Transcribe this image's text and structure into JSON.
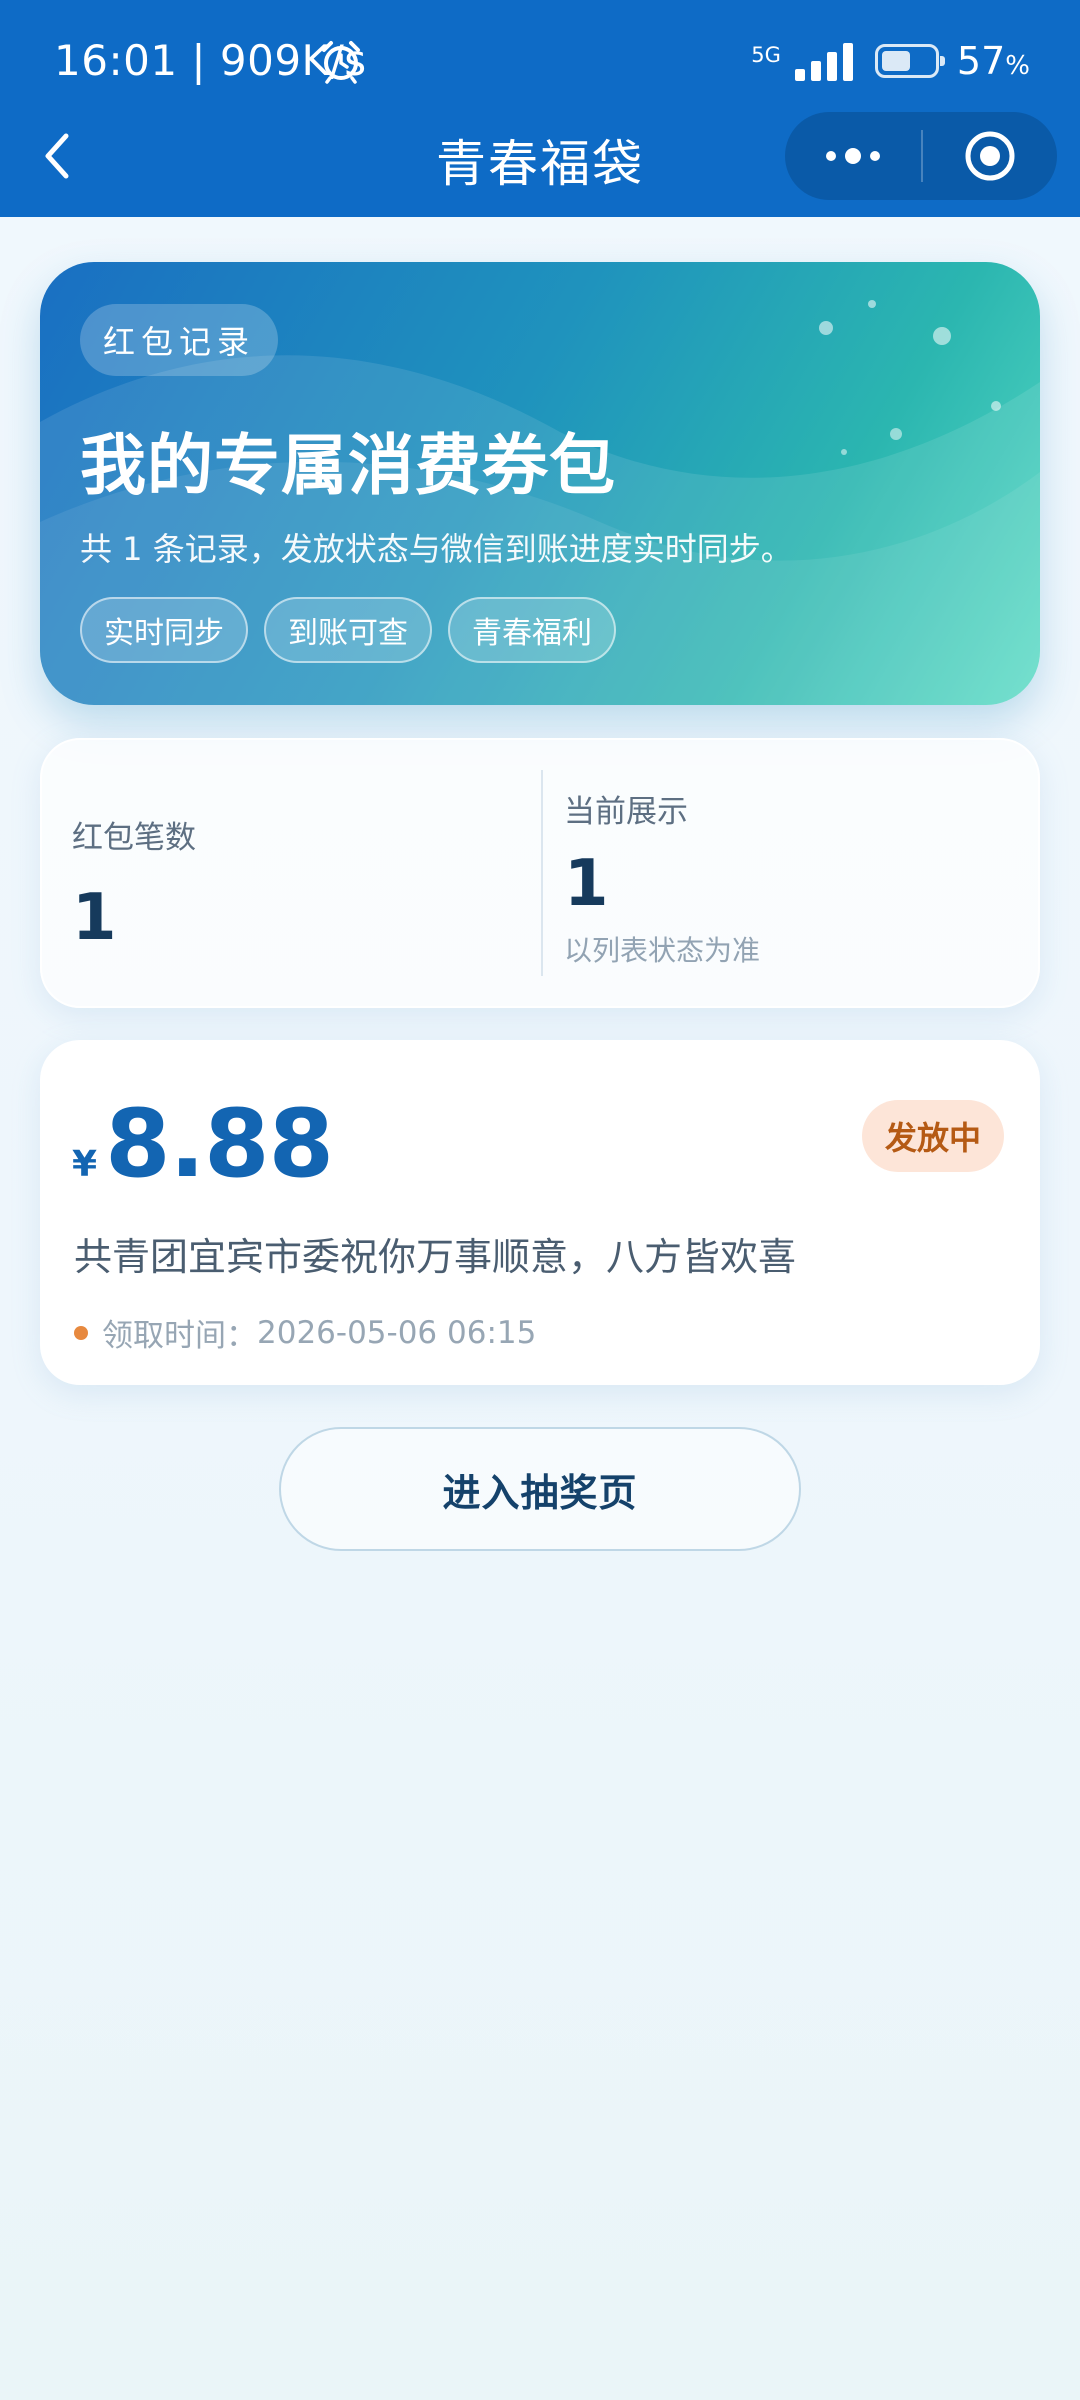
{
  "status_bar": {
    "time": "16:01 | 909K/s",
    "network": "5G",
    "battery_pct": "57",
    "battery_unit": "%",
    "battery_level": 0.57
  },
  "nav": {
    "title": "青春福袋"
  },
  "hero": {
    "chip": "红包记录",
    "title": "我的专属消费券包",
    "desc": "共 1 条记录，发放状态与微信到账进度实时同步。",
    "tags": [
      "实时同步",
      "到账可查",
      "青春福利"
    ]
  },
  "stats": {
    "count_label": "红包笔数",
    "count_value": "1",
    "current_label": "当前展示",
    "current_value": "1",
    "current_note": "以列表状态为准"
  },
  "packet": {
    "currency": "¥",
    "amount": "8.88",
    "status": "发放中",
    "blessing": "共青团宜宾市委祝你万事顺意，八方皆欢喜",
    "time_label": "领取时间：",
    "time_value": "2026-05-06 06:15"
  },
  "actions": {
    "lottery_label": "进入抽奖页"
  },
  "colors": {
    "topbar": "#0e6bc6",
    "accent": "#1365b2",
    "badge_bg": "#fde5d8",
    "badge_text": "#b55a14",
    "dot": "#e7893f"
  }
}
